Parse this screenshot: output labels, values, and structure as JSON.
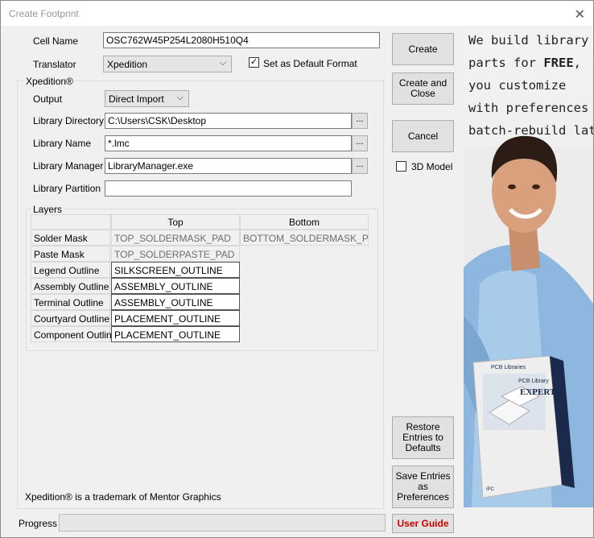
{
  "window": {
    "title": "Create Footprint"
  },
  "cell_name": {
    "label": "Cell Name",
    "value": "OSC762W45P254L2080H510Q4"
  },
  "translator": {
    "label": "Translator",
    "value": "Xpedition",
    "default_label": "Set as Default Format",
    "default_checked": true
  },
  "xpedition": {
    "group_label": "Xpedition®",
    "output_label": "Output",
    "output_value": "Direct Import",
    "lib_dir_label": "Library Directory",
    "lib_dir_value": "C:\\Users\\CSK\\Desktop",
    "lib_name_label": "Library Name",
    "lib_name_value": "*.lmc",
    "lib_mgr_label": "Library Manager",
    "lib_mgr_value": "LibraryManager.exe",
    "lib_part_label": "Library Partition",
    "lib_part_value": "",
    "browse": "..."
  },
  "layers": {
    "group_label": "Layers",
    "col_top": "Top",
    "col_bottom": "Bottom",
    "rows": [
      {
        "name": "Solder Mask",
        "top": "TOP_SOLDERMASK_PAD",
        "bottom": "BOTTOM_SOLDERMASK_PAD"
      },
      {
        "name": "Paste Mask",
        "top": "TOP_SOLDERPASTE_PAD",
        "bottom": ""
      },
      {
        "name": "Legend Outline",
        "top": "SILKSCREEN_OUTLINE",
        "bottom": ""
      },
      {
        "name": "Assembly Outline",
        "top": "ASSEMBLY_OUTLINE",
        "bottom": ""
      },
      {
        "name": "Terminal Outline",
        "top": "ASSEMBLY_OUTLINE",
        "bottom": ""
      },
      {
        "name": "Courtyard Outline",
        "top": "PLACEMENT_OUTLINE",
        "bottom": ""
      },
      {
        "name": "Component Outline",
        "top": "PLACEMENT_OUTLINE",
        "bottom": ""
      }
    ]
  },
  "trademark": "Xpedition® is a trademark of Mentor Graphics",
  "buttons": {
    "create": "Create",
    "create_close": "Create and\nClose",
    "cancel": "Cancel",
    "model_3d": "3D Model",
    "restore": "Restore\nEntries to\nDefaults",
    "save": "Save Entries\nas\nPreferences",
    "user_guide": "User Guide"
  },
  "progress": {
    "label": "Progress",
    "value": 0
  },
  "ad": {
    "headline": "We build library\nparts for FREE,\nyou customize\nwith preferences &\nbatch-rebuild later!",
    "box_brand": "PCB Libraries",
    "box_title": "PCB Library",
    "box_product": "EXPERT",
    "box_footer": "IPC"
  },
  "colors": {
    "user_guide": "#cc0000",
    "ad_box": "#1b2a4a"
  }
}
